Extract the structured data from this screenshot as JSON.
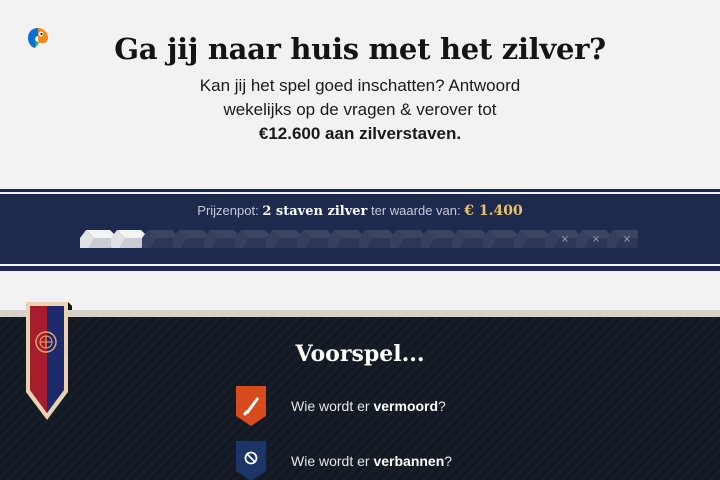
{
  "header": {
    "title": "Ga jij naar huis met het zilver?",
    "intro_line1": "Kan jij het spel goed inschatten? Antwoord",
    "intro_line2": "wekelijks op de vragen & verover tot",
    "intro_highlight": "€12.600 aan zilverstaven."
  },
  "prize": {
    "label": "Prijzenpot:",
    "amount": "2 staven zilver",
    "value_label": "ter waarde van:",
    "value": "€ 1.400",
    "bars_total": 18,
    "bars_won": 2
  },
  "main": {
    "heading": "Voorspel...",
    "questions": [
      {
        "prefix": "Wie wordt er ",
        "keyword": "vermoord",
        "suffix": "?",
        "icon": "knife-icon",
        "color": "#d94a1e"
      },
      {
        "prefix": "Wie wordt er ",
        "keyword": "verbannen",
        "suffix": "?",
        "icon": "banned-icon",
        "color": "#1d3566"
      }
    ]
  },
  "colors": {
    "band": "#1d2a4d",
    "dark_bg": "#131a24",
    "gold": "#e7c36a",
    "banner_red": "#a61d2c",
    "banner_blue": "#1d2a6b"
  }
}
